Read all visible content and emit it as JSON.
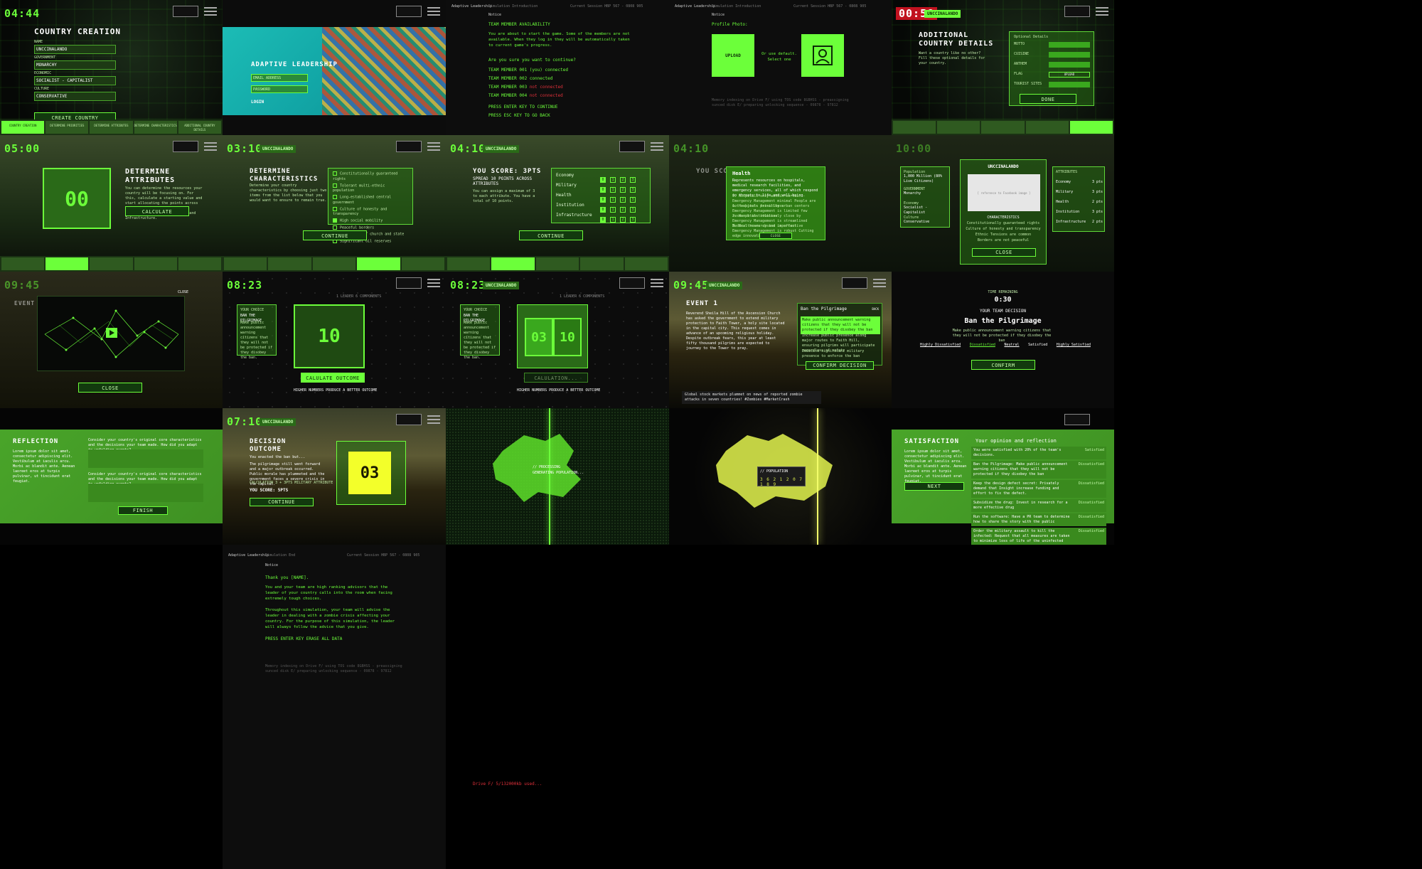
{
  "app": {
    "name": "Adaptive Leadership"
  },
  "tiles": {
    "country_creation": {
      "timer": "04:44",
      "title": "COUNTRY CREATION",
      "fields": [
        {
          "label": "NAME",
          "value": "UNCCINALANDO"
        },
        {
          "label": "GOVERNMENT",
          "value": "MONARCHY"
        },
        {
          "label": "ECONOMIC",
          "value": "SOCIALIST - CAPITALIST"
        },
        {
          "label": "CULTURE",
          "value": "CONSERVATIVE"
        }
      ],
      "button": "CREATE COUNTRY",
      "steps": [
        "COUNTRY CREATION",
        "DETERMINE PRIORITIES",
        "DETERMINE ATTRIBUTES",
        "DETERMINE CHARACTERISTICS",
        "ADDITIONAL COUNTRY DETAILS"
      ]
    },
    "login": {
      "title": "ADAPTIVE LEADERSHIP",
      "email_placeholder": "EMAIL ADDRESS",
      "password_placeholder": "PASSWORD",
      "button": "LOGIN"
    },
    "team_terminal": {
      "header_left": "Adaptive Leadership",
      "header_mid": "Simulation Introduction",
      "header_right": "Current Session HBP 567 - 0808 905",
      "notice": "Notice",
      "title": "TEAM MEMBER AVAILABILITY",
      "body": "You are about to start the game. Some of the members are not available. When they log in they will be automatically taken to current game's progress.",
      "question": "Are you sure you want to continue?",
      "members": [
        {
          "name": "TEAM MEMBER 001 (you)",
          "status": "connected",
          "ok": true
        },
        {
          "name": "TEAM MEMBER 002",
          "status": "connected",
          "ok": true
        },
        {
          "name": "TEAM MEMBER 003",
          "status": "not connected",
          "ok": false
        },
        {
          "name": "TEAM MEMBER 004",
          "status": "not connected",
          "ok": false
        }
      ],
      "enter": "PRESS ENTER KEY TO CONTINUE",
      "esc": "PRESS ESC KEY TO GO BACK"
    },
    "profile": {
      "header_left": "Adaptive Leadership",
      "header_mid": "Simulation Introduction",
      "header_right": "Current Session HBP 567 - 0808 905",
      "notice": "Notice",
      "label": "Profile Photo:",
      "upload": "UPLOAD",
      "alt": "Or use default. Select one",
      "footer": "Memory indexing on Drive F/ using TOS code 8GBHSS - preassigning sunced disk E/ preparing unlocking sequence - 09878 - 97812"
    },
    "additional": {
      "timer": "00:58",
      "uv": "UNCCINALANDO",
      "title": "ADDITIONAL COUNTRY DETAILS",
      "sub": "Want a country like no other? Fill these optional details for your country.",
      "panel_title": "Optional Details",
      "fields": [
        "MOTTO",
        "CUISINE",
        "ANTHEM",
        "FLAG",
        "TOURIST SITES"
      ],
      "flag_btn": "UPLOAD",
      "done": "DONE"
    },
    "attributes": {
      "timer": "05:00",
      "title": "DETERMINE ATTRIBUTES",
      "value": "00",
      "body": "You can determine the resources your country will be focusing on. For this, calculate a starting value and start allocating the points across various attributes: Economy, Military, Health, Institution and Infrastructure.",
      "button": "CALCULATE"
    },
    "characteristics": {
      "timer": "03:10",
      "uv": "UNCCINALANDO",
      "title": "DETERMINE CHARACTERISTICS",
      "body": "Determine your country characteristics by choosing just two items from the list below that you would want to ensure to remain true.",
      "items": [
        {
          "label": "Constitutionally guaranteed rights",
          "on": false
        },
        {
          "label": "Tolerant multi-ethnic population",
          "on": false
        },
        {
          "label": "Long-established central government",
          "on": false
        },
        {
          "label": "Culture of honesty and transparency",
          "on": false
        },
        {
          "label": "High social mobility",
          "on": true
        },
        {
          "label": "Peaceful borders",
          "on": false
        },
        {
          "label": "Separation of church and state",
          "on": false
        },
        {
          "label": "Significant oil reserves",
          "on": false
        }
      ],
      "button": "CONTINUE"
    },
    "score": {
      "timer": "04:10",
      "uv": "UNCCINALANDO",
      "title": "YOU SCORE: 3PTS",
      "sub": "SPREAD 10 POINTS ACROSS ATTRIBUTES",
      "note": "You can assign a maximum of 3 to each attribute. You have a total of 10 points.",
      "rows": [
        "Economy",
        "Military",
        "Health",
        "Institution",
        "Infrastructure"
      ],
      "scale": [
        "0",
        "1",
        "2",
        "3"
      ],
      "button": "CONTINUE"
    },
    "health_modal": {
      "timer": "04:10",
      "title": "YOU SCO",
      "heading": "Health",
      "body": "Represents resources on hospitals, medical research facilities, and emergency services, all of which respond to threats to life and well-being.",
      "levels": [
        "0. Hospitals only within certain Emergency Management minimal People are not subjects for illness",
        "1. Hospitals primarily urban centers Emergency Management is limited few research institutions",
        "2. Hospitals relatively close by Emergency Management is streamlined Medical research and important",
        "3. Healthcare system is effective Emergency Management is robust Cutting edge innovations"
      ],
      "close": "CLOSE"
    },
    "summary": {
      "timer": "10:00",
      "uv": "UNCCINALANDO",
      "population": "Population",
      "population_val": "1,000 Million (80% Live Citizens)",
      "government": "GOVERNMENT",
      "government_val": "Monarchy",
      "economy": "Economy",
      "economy_val": "Socialist - Capitalist",
      "culture": "Culture",
      "culture_val": "Conservative",
      "flag_text": "[ reference to Facebook image ]",
      "char_title": "CHARACTERISTICS",
      "chars": [
        "Constitutionally guaranteed rights",
        "Culture of honesty and transparency",
        "Ethnic Tensions are common",
        "Borders are not peaceful"
      ],
      "attr_title": "ATTRIBUTES",
      "attrs": [
        {
          "name": "Economy",
          "val": "3 pts"
        },
        {
          "name": "Military",
          "val": "3 pts"
        },
        {
          "name": "Health",
          "val": "2 pts"
        },
        {
          "name": "Institution",
          "val": "3 pts"
        },
        {
          "name": "Infrastructure",
          "val": "2 pts"
        }
      ],
      "close": "CLOSE"
    },
    "video": {
      "timer": "09:45",
      "close_top": "CLOSE",
      "close": "CLOSE",
      "event": "EVENT"
    },
    "choice1": {
      "timer": "08:23",
      "top": "1 LEADER 6 COMPONENTS",
      "choice_title": "YOUR CHOICE",
      "choice_name": "BAN THE PILGRIMAGE",
      "choice_body": "Make public announcement warning citizens that they will not be protected if they disobey the ban.",
      "value": "10",
      "button": "CALULATE OUTCOME",
      "hint": "HIGHER NUMBERS PRODUCE A BETTER OUTCOME"
    },
    "choice2": {
      "timer": "08:23",
      "uv": "UNCCINALANDO",
      "top": "1 LEADER 6 COMPONENTS",
      "choice_title": "YOUR CHOICE",
      "choice_name": "BAN THE PILGRIMAGE",
      "choice_body": "Make public announcement warning citizens that they will not be protected if they disobey the ban.",
      "left": "03",
      "right": "10",
      "button": "CALULATION...",
      "hint": "HIGHER NUMBERS PRODUCE A BETTER OUTCOME"
    },
    "event1": {
      "timer": "09:45",
      "uv": "UNCCINALANDO",
      "title": "EVENT 1",
      "body": "Reverend Sheila Hill of the Ascension Church has asked the government to extend military protection to Faith Tower, a holy site located in the capital city. This request comes in advance of an upcoming religious holiday. Despite outbreak fears, this year at least fifty thousand pilgrims are expected to journey to the Tower to pray.",
      "option_title": "Ban the Pilgrimage",
      "back": "BACK",
      "option_1": "Make public announcement warning citizens that they will not be protected if they disobey the ban",
      "option_2": "Increase public presence along major routes to Faith Hill, ensuring pilgrims will participate regardless of safety",
      "option_3": "Dedicate significant military presence to enforce the ban",
      "confirm": "CONFIRM DECISION",
      "ticker": "Global stock markets plummet on news of reported zombie attacks in seven countries! #Zombies #MarketCrash"
    },
    "team_decision": {
      "time_label": "TIME REMAINING",
      "time": "0:30",
      "label": "YOUR TEAM DECISION",
      "decision": "Ban the Pilgrimage",
      "body": "Make public announcement warning citizens that they will not be protected if they disobey the ban",
      "scale": [
        "Highly Dissatisfied",
        "Dissatisfied",
        "Neutral",
        "Satisfied",
        "Highly Satisfied"
      ],
      "confirm": "CONFIRM"
    },
    "reflection": {
      "title": "REFLECTION",
      "body": "Lorem ipsum dolor sit amet, consectetur adipiscing elit. Vestibulum at iaculis arcu. Morbi ac blandit ante. Aenean laoreet eros at turpis pulvinar, ut tincidunt erat feugiat.",
      "q1": "Consider your country's original core characteristics and the decisions your team made. How did you adapt to unfolding events?",
      "q2": "Consider your country's original core characteristics and the decisions your team made. How did you adapt to unfolding events?",
      "finish": "FINISH"
    },
    "outcome": {
      "timer": "07:10",
      "uv": "UNCCINALANDO",
      "title": "DECISION OUTCOME",
      "sub": "You enacted the ban but...",
      "body": "The pilgrimage still went forward and a major outbreak occurred. Public morale has plummeted and the government faces a severe crisis in the capital.",
      "calc": "CALCULATION 3 + 3PTS MILITARY ATTRIBUTE",
      "score": "YOU SCORE: 5PTS",
      "value": "03",
      "button": "CONTINUE"
    },
    "map1": {
      "label": "// PROCESSING",
      "sub": "GENERATING POPULATION..."
    },
    "map2": {
      "label": "// POPULATION",
      "value": "3 6 2 1 2 0 7 1 8 9"
    },
    "satisfaction": {
      "title": "SATISFACTION",
      "body": "Lorem ipsum dolor sit amet, consectetur adipiscing elit. Vestibulum at iaculis arcu. Morbi ac blandit ante. Aenean laoreet eros at turpis pulvinar, ut tincidunt erat feugiat.",
      "next": "NEXT",
      "header": "Your opinion and reflection",
      "rows": [
        {
          "text": "You were satisfied with 20% of the team's decisions.",
          "val": "Satisfied"
        },
        {
          "text": "Ban the Pilgrimage: Make public announcement warning citizens that they will not be protected if they disobey the ban",
          "val": "Dissatisfied"
        },
        {
          "text": "Keep the design defect secret: Privately demand that Insight increase funding and effort to fix the defect.",
          "val": "Dissatisfied"
        },
        {
          "text": "Subsidize the drug: Invest in research for a more effective drug",
          "val": "Dissatisfied"
        },
        {
          "text": "Run the software: Have a PR team to determine how to share the story with the public",
          "val": "Dissatisfied"
        },
        {
          "text": "Order the military assault to kill the infected: Request that all measures are taken to minimize loss of life of the uninfected",
          "val": "Dissatisfied"
        }
      ]
    },
    "end_terminal": {
      "header_left": "Adaptive Leadership",
      "header_mid": "Simulation End",
      "header_right": "Current Session HBP 567 - 0808 905",
      "notice": "Notice",
      "thanks": "Thank you [NAME].",
      "p1": "You and your team are high ranking advisors that the leader of your country calls into the room when facing extremely tough choices.",
      "p2": "Throughout this simulation, your team will advise the leader in dealing with a zombie crisis affecting your country. For the purpose of this simulation, the leader will always follow the advice that you give.",
      "enter": "PRESS ENTER KEY ERASE ALL DATA",
      "drive": "Drive F/ 5/132000kb used...",
      "footer": "Memory indexing on Drive F/ using TOS code 8GBHSS - preassigning sunced disk E/ preparing unlocking sequence - 09878 - 97812"
    }
  }
}
